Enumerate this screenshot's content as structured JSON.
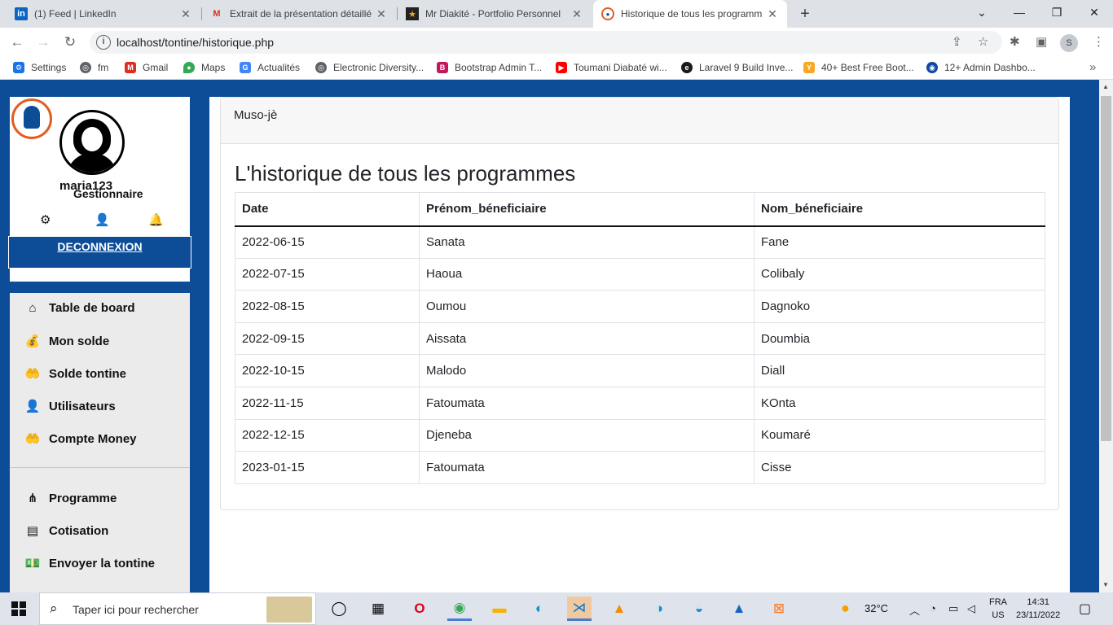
{
  "browser": {
    "tabs": [
      {
        "title": "(1) Feed | LinkedIn",
        "icon": "linkedin-icon"
      },
      {
        "title": "Extrait de la présentation détaillé",
        "icon": "gmail-icon"
      },
      {
        "title": "Mr Diakité - Portfolio Personnel",
        "icon": "star-icon"
      },
      {
        "title": "Historique de tous les programm",
        "icon": "site-logo-icon"
      }
    ],
    "url": "localhost/tontine/historique.php",
    "profile_initial": "S",
    "bookmarks": [
      {
        "label": "Settings",
        "color": "#1a73e8"
      },
      {
        "label": "fm",
        "color": "#5f6368"
      },
      {
        "label": "Gmail",
        "color": "#d93025"
      },
      {
        "label": "Maps",
        "color": "#34a853"
      },
      {
        "label": "Actualités",
        "color": "#4285f4"
      },
      {
        "label": "Electronic Diversity...",
        "color": "#5f6368"
      },
      {
        "label": "Bootstrap Admin T...",
        "color": "#c2185b"
      },
      {
        "label": "Toumani Diabaté wi...",
        "color": "#ff0000"
      },
      {
        "label": "Laravel 9 Build Inve...",
        "color": "#1a1a1a"
      },
      {
        "label": "40+ Best Free Boot...",
        "color": "#f9a825"
      },
      {
        "label": "12+ Admin Dashbo...",
        "color": "#0d47a1"
      }
    ]
  },
  "sidebar": {
    "username": "maria123",
    "role": "Gestionnaire",
    "logout_label": "DECONNEXION",
    "menu": [
      {
        "label": "Table de board",
        "icon": "home-icon"
      },
      {
        "label": "Mon solde",
        "icon": "money-bag-icon"
      },
      {
        "label": "Solde tontine",
        "icon": "hand-coin-icon"
      },
      {
        "label": "Utilisateurs",
        "icon": "user-plus-icon"
      },
      {
        "label": "Compte Money",
        "icon": "hand-coin-icon"
      },
      {
        "label": "Programme",
        "icon": "network-icon"
      },
      {
        "label": "Cotisation",
        "icon": "card-icon"
      },
      {
        "label": "Envoyer la tontine",
        "icon": "cash-icon"
      }
    ]
  },
  "main": {
    "card_header": "Muso-jè",
    "title": "L'historique de tous les programmes",
    "table": {
      "headers": [
        "Date",
        "Prénom_béneficiaire",
        "Nom_béneficiaire"
      ],
      "rows": [
        [
          "2022-06-15",
          "Sanata",
          "Fane"
        ],
        [
          "2022-07-15",
          "Haoua",
          "Colibaly"
        ],
        [
          "2022-08-15",
          "Oumou",
          "Dagnoko"
        ],
        [
          "2022-09-15",
          "Aissata",
          "Doumbia"
        ],
        [
          "2022-10-15",
          "Malodo",
          "Diall"
        ],
        [
          "2022-11-15",
          "Fatoumata",
          "KOnta"
        ],
        [
          "2022-12-15",
          "Djeneba",
          "Koumaré"
        ],
        [
          "2023-01-15",
          "Fatoumata",
          "Cisse"
        ]
      ]
    }
  },
  "taskbar": {
    "search_placeholder": "Taper ici pour rechercher",
    "weather": "32°C",
    "lang_top": "FRA",
    "lang_bottom": "US",
    "time": "14:31",
    "date": "23/11/2022"
  },
  "colors": {
    "brand_blue": "#0d4c97",
    "logo_orange": "#e35d21"
  }
}
